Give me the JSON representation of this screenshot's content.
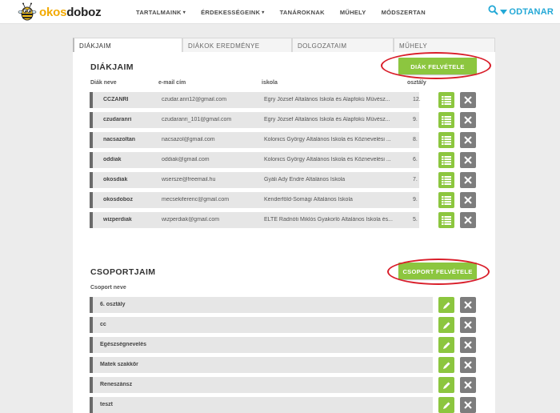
{
  "header": {
    "logo": {
      "part1": "okos",
      "part2": "doboz"
    },
    "nav": [
      {
        "label": "TARTALMAINK",
        "has_caret": true
      },
      {
        "label": "ÉRDEKESSÉGEINK",
        "has_caret": true
      },
      {
        "label": "TANÁROKNAK",
        "has_caret": false
      },
      {
        "label": "MŰHELY",
        "has_caret": false
      },
      {
        "label": "MÓDSZERTAN",
        "has_caret": false
      }
    ],
    "user_label": "ODTANAR",
    "caret_glyph": "▾"
  },
  "tabs": [
    "DIÁKJAIM",
    "DIÁKOK EREDMÉNYE",
    "DOLGOZATAIM",
    "MŰHELY"
  ],
  "students": {
    "title": "DIÁKJAIM",
    "add_button": "DIÁK FELVÉTELE",
    "columns": {
      "name": "Diák neve",
      "email": "e-mail cím",
      "school": "iskola",
      "grade": "osztály"
    },
    "rows": [
      {
        "name": "CCZANRI",
        "email": "czudar.anri12@gmail.com",
        "school": "Egry József Általános Iskola és Alapfokú Művész...",
        "grade": "12."
      },
      {
        "name": "czudaranri",
        "email": "czudaranri_101@gmail.com",
        "school": "Egry József Általános Iskola és Alapfokú Művész...",
        "grade": "9."
      },
      {
        "name": "nacsazoltan",
        "email": "nacsazol@gmail.com",
        "school": "Kolonics György Általános Iskola és Köznevelési ...",
        "grade": "8."
      },
      {
        "name": "oddiak",
        "email": "oddiak@gmail.com",
        "school": "Kolonics György Általános Iskola és Köznevelési ...",
        "grade": "6."
      },
      {
        "name": "okosdiak",
        "email": "wsersze@freemail.hu",
        "school": "Gyáli Ady Endre Általános Iskola",
        "grade": "7."
      },
      {
        "name": "okosdoboz",
        "email": "mecsekiferenc@gmail.com",
        "school": "Kenderföld-Somági Általános Iskola",
        "grade": "9."
      },
      {
        "name": "wizperdiak",
        "email": "wizperdiak@gmail.com",
        "school": "ELTE Radnóti Miklós Gyakorló Általános Iskola és...",
        "grade": "5."
      }
    ]
  },
  "groups": {
    "title": "CSOPORTJAIM",
    "add_button": "CSOPORT FELVÉTELE",
    "column_name": "Csoport neve",
    "rows": [
      {
        "name": "6. osztály"
      },
      {
        "name": "cc"
      },
      {
        "name": "Egészségnevelés"
      },
      {
        "name": "Matek szakkör"
      },
      {
        "name": "Reneszánsz"
      },
      {
        "name": "teszt"
      }
    ]
  },
  "colors": {
    "accent_green": "#8cc63f",
    "brand_blue": "#23a8d6",
    "highlight_red": "#d91e2a",
    "logo_yellow": "#f2a900"
  }
}
